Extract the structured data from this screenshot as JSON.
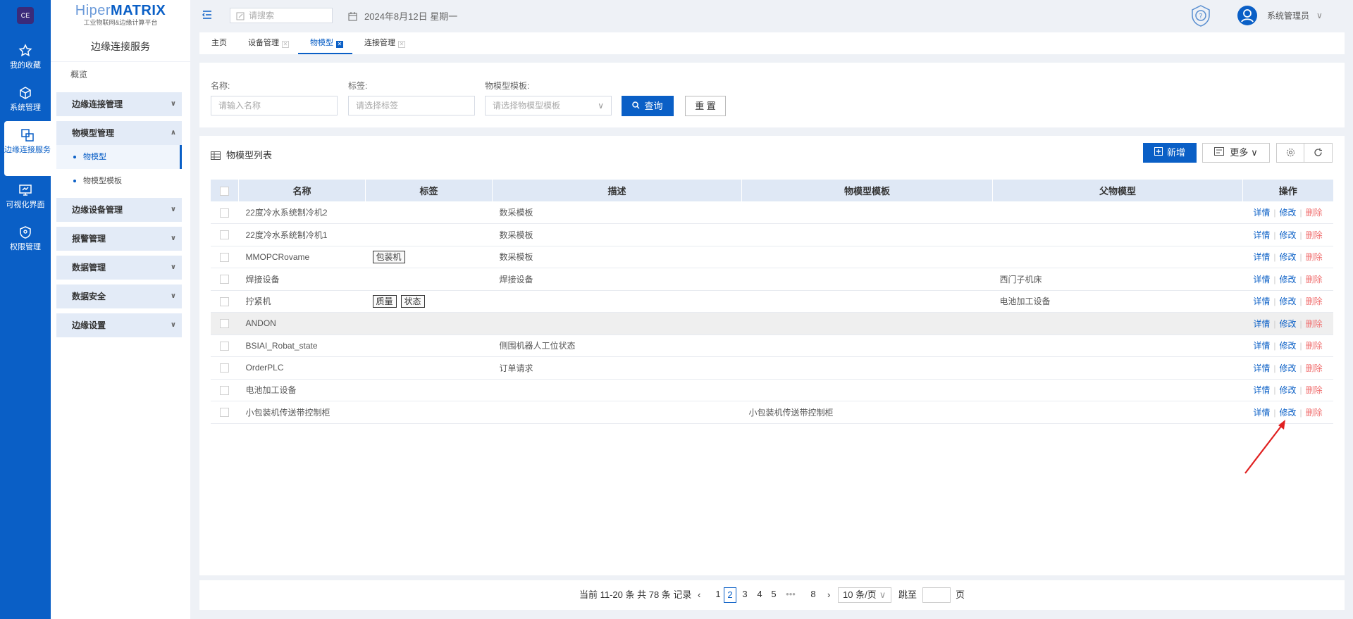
{
  "leftbar": {
    "items": [
      {
        "label": "我的收藏",
        "icon": "star-icon"
      },
      {
        "label": "系统管理",
        "icon": "cube-icon"
      },
      {
        "label": "边缘连接服务",
        "icon": "copy-icon"
      },
      {
        "label": "可视化界面",
        "icon": "monitor-icon"
      },
      {
        "label": "权限管理",
        "icon": "shield-icon"
      }
    ]
  },
  "sidebar": {
    "logo_main": "Hiper",
    "logo_accent": "MATRIX",
    "logo_sub": "工业物联网&边缘计算平台",
    "title": "边缘连接服务",
    "overview": "概览",
    "groups": [
      {
        "label": "边缘连接管理"
      },
      {
        "label": "物模型管理",
        "children": [
          {
            "label": "物模型"
          },
          {
            "label": "物模型模板"
          }
        ]
      },
      {
        "label": "边缘设备管理"
      },
      {
        "label": "报警管理"
      },
      {
        "label": "数据管理"
      },
      {
        "label": "数据安全"
      },
      {
        "label": "边缘设置"
      }
    ]
  },
  "topbar": {
    "search_placeholder": "请搜索",
    "date": "2024年8月12日 星期一",
    "user": "系统管理员"
  },
  "tabs": [
    {
      "label": "主页"
    },
    {
      "label": "设备管理"
    },
    {
      "label": "物模型"
    },
    {
      "label": "连接管理"
    }
  ],
  "filter": {
    "name_label": "名称:",
    "name_placeholder": "请输入名称",
    "tag_label": "标签:",
    "tag_placeholder": "请选择标签",
    "template_label": "物模型模板:",
    "template_placeholder": "请选择物模型模板",
    "query": "查询",
    "reset": "重 置"
  },
  "list": {
    "title": "物模型列表",
    "add": "新增",
    "more": "更多",
    "columns": [
      "名称",
      "标签",
      "描述",
      "物模型模板",
      "父物模型",
      "操作"
    ],
    "ops": {
      "detail": "详情",
      "edit": "修改",
      "delete": "删除"
    },
    "rows": [
      {
        "name": "22度冷水系统制冷机2",
        "tags": [],
        "desc": "数采模板",
        "template": "",
        "parent": ""
      },
      {
        "name": "22度冷水系统制冷机1",
        "tags": [],
        "desc": "数采模板",
        "template": "",
        "parent": ""
      },
      {
        "name": "MMOPCRovame",
        "tags": [
          "包装机"
        ],
        "desc": "数采模板",
        "template": "",
        "parent": ""
      },
      {
        "name": "焊接设备",
        "tags": [],
        "desc": "焊接设备",
        "template": "",
        "parent": "西门子机床"
      },
      {
        "name": "拧紧机",
        "tags": [
          "质量",
          "状态"
        ],
        "desc": "",
        "template": "",
        "parent": "电池加工设备"
      },
      {
        "name": "ANDON",
        "tags": [],
        "desc": "",
        "template": "",
        "parent": ""
      },
      {
        "name": "BSIAI_Robat_state",
        "tags": [],
        "desc": "侧围机器人工位状态",
        "template": "",
        "parent": ""
      },
      {
        "name": "OrderPLC",
        "tags": [],
        "desc": "订单请求",
        "template": "",
        "parent": ""
      },
      {
        "name": "电池加工设备",
        "tags": [],
        "desc": "",
        "template": "",
        "parent": ""
      },
      {
        "name": "小包装机传送带控制柜",
        "tags": [],
        "desc": "",
        "template": "小包装机传送带控制柜",
        "parent": ""
      }
    ]
  },
  "pager": {
    "summary": "当前 11-20 条 共 78 条 记录",
    "pages": [
      "1",
      "2",
      "3",
      "4",
      "5",
      "•••",
      "8"
    ],
    "current_page": "2",
    "page_size": "10 条/页",
    "jump_label": "跳至",
    "page_unit": "页"
  },
  "colors": {
    "primary": "#0a5fc6",
    "danger": "#f07070",
    "annotation_arrow": "#e02020"
  }
}
